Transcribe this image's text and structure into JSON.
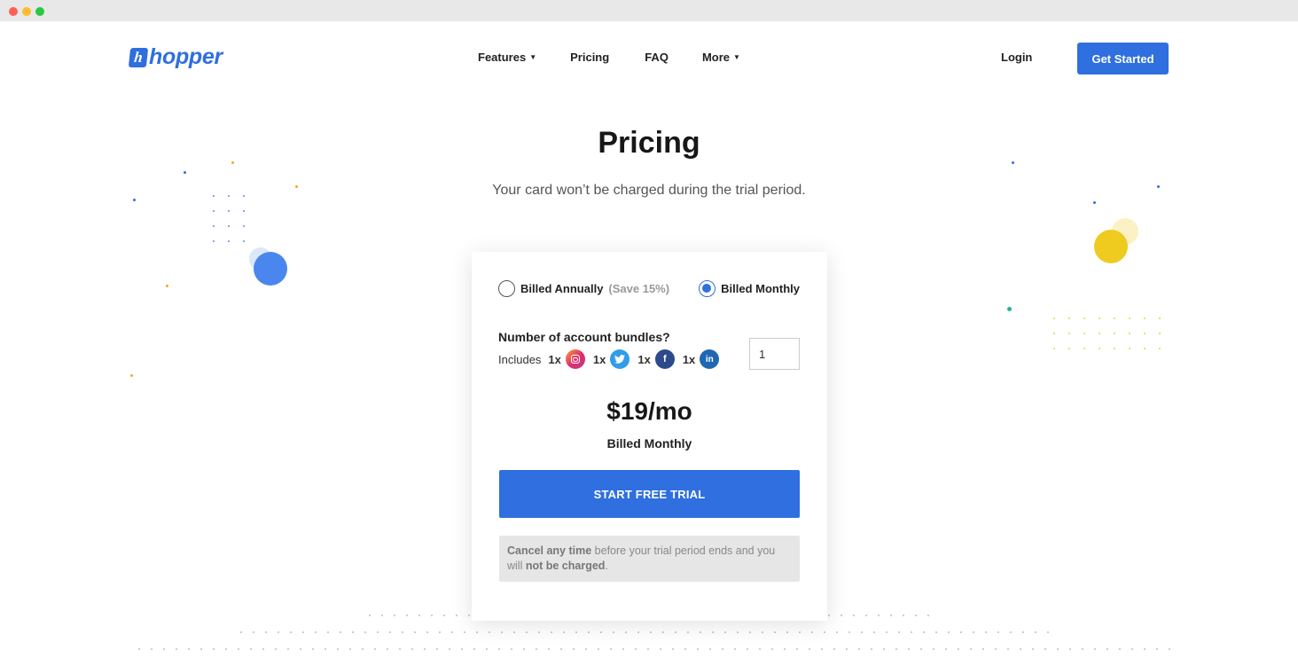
{
  "window": {
    "controls": [
      "close",
      "minimize",
      "maximize"
    ]
  },
  "header": {
    "logo_mark": "h",
    "logo_text": "hopper",
    "nav": [
      {
        "label": "Features",
        "has_dropdown": true
      },
      {
        "label": "Pricing",
        "has_dropdown": false
      },
      {
        "label": "FAQ",
        "has_dropdown": false
      },
      {
        "label": "More",
        "has_dropdown": true
      }
    ],
    "login_label": "Login",
    "get_started_label": "Get Started"
  },
  "hero": {
    "title": "Pricing",
    "subtitle": "Your card won’t be charged during the trial period."
  },
  "plan_card": {
    "billing_options": [
      {
        "label": "Billed Annually",
        "note": "(Save 15%)",
        "selected": false
      },
      {
        "label": "Billed Monthly",
        "note": "",
        "selected": true
      }
    ],
    "bundles_label": "Number of account bundles?",
    "includes_label": "Includes",
    "includes": [
      {
        "count": "1x",
        "icon": "instagram-icon"
      },
      {
        "count": "1x",
        "icon": "twitter-icon"
      },
      {
        "count": "1x",
        "icon": "facebook-icon"
      },
      {
        "count": "1x",
        "icon": "linkedin-icon"
      }
    ],
    "bundle_quantity": "1",
    "price": "$19/mo",
    "price_note": "Billed Monthly",
    "cta_label": "START FREE TRIAL",
    "notice": {
      "part1": "Cancel any time",
      "part2": " before your trial period ends and you will ",
      "part3": "not be charged",
      "part4": "."
    }
  },
  "colors": {
    "brand": "#2f6fdf",
    "accent_yellow": "#eecb1e",
    "accent_teal": "#1fb59a",
    "accent_orange": "#f5a623"
  }
}
